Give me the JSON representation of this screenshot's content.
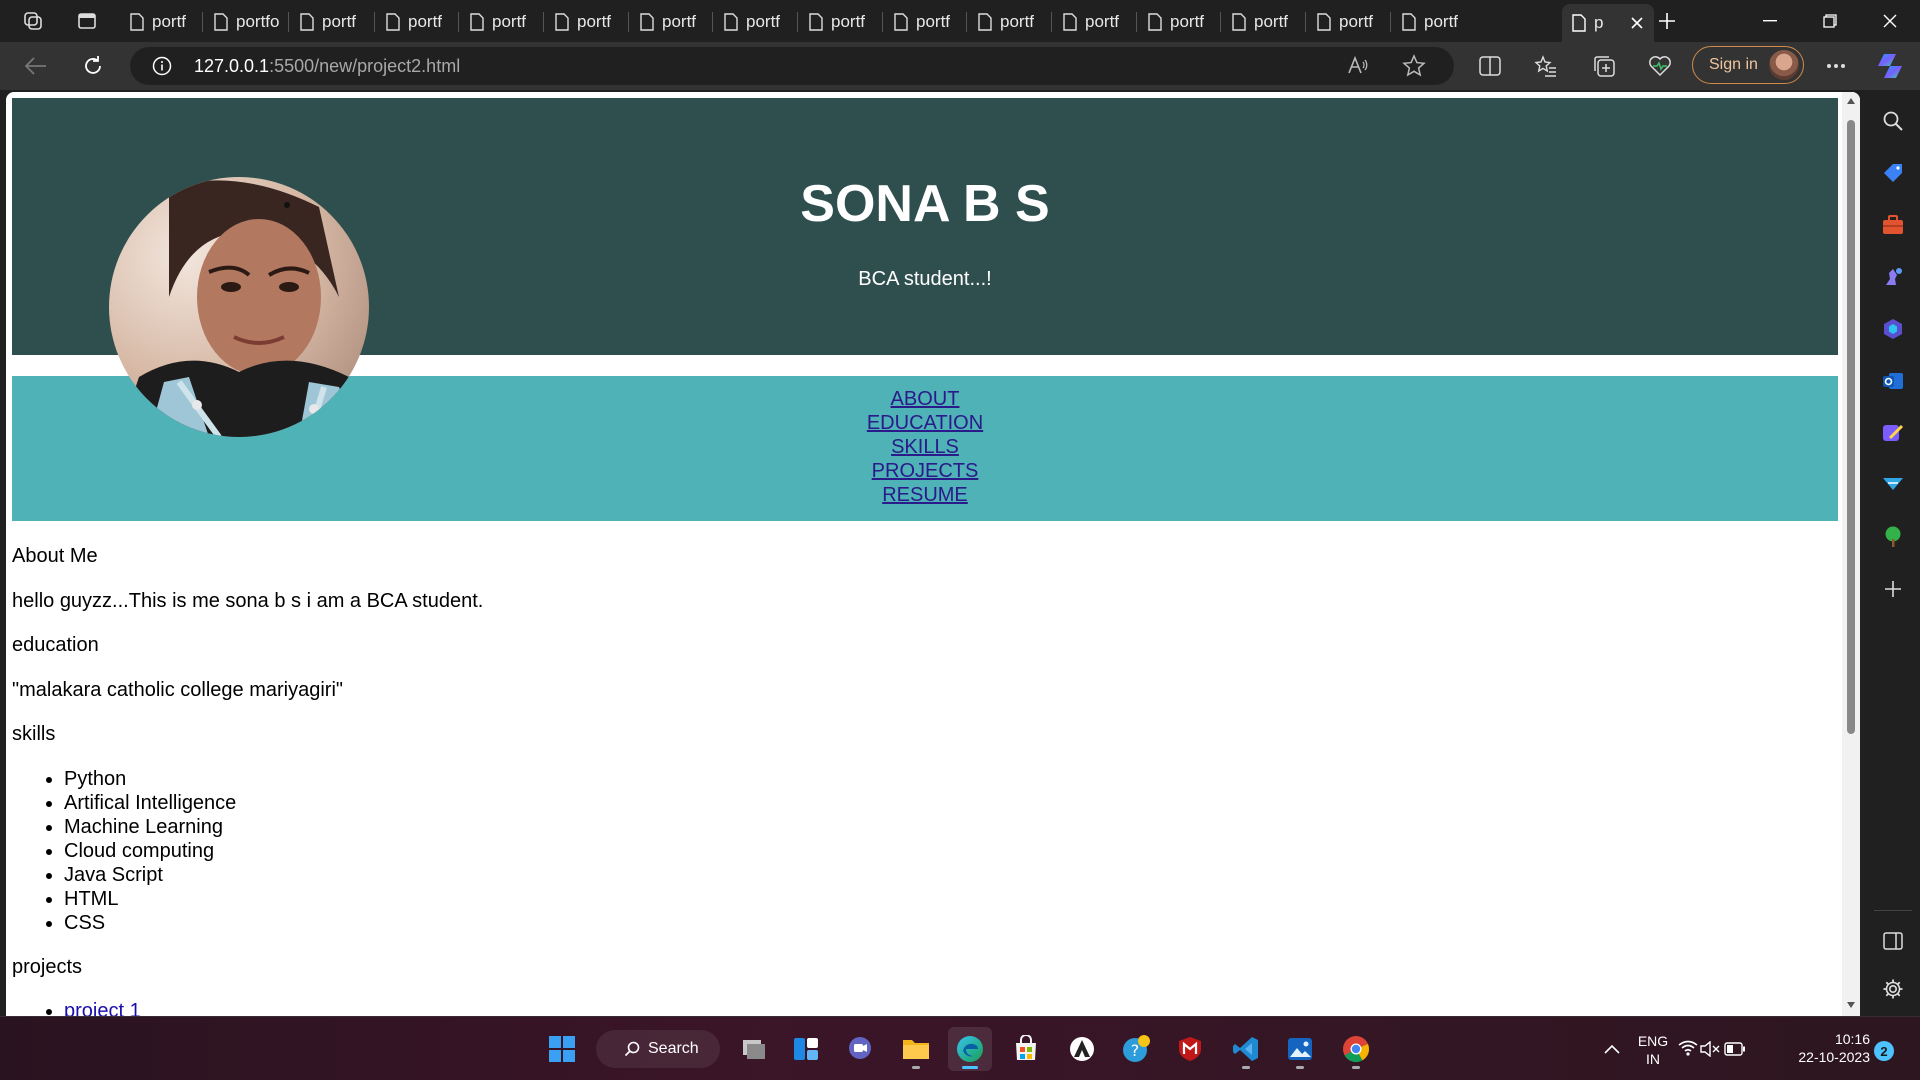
{
  "browser": {
    "tabs": [
      {
        "label": "portf"
      },
      {
        "label": "portfo"
      },
      {
        "label": "portf"
      },
      {
        "label": "portf"
      },
      {
        "label": "portf"
      },
      {
        "label": "portf"
      },
      {
        "label": "portf"
      },
      {
        "label": "portf"
      },
      {
        "label": "portf"
      },
      {
        "label": "portf"
      },
      {
        "label": "portf"
      },
      {
        "label": "portf"
      },
      {
        "label": "portf"
      },
      {
        "label": "portf"
      },
      {
        "label": "portf"
      },
      {
        "label": "portf"
      }
    ],
    "active_tab_label": "p",
    "url_host": "127.0.0.1",
    "url_path": ":5500/new/project2.html",
    "sign_in_label": "Sign in"
  },
  "page": {
    "name": "SONA B S",
    "subtitle": "BCA student...!",
    "nav": [
      "ABOUT",
      "EDUCATION",
      "SKILLS",
      "PROJECTS",
      "RESUME"
    ],
    "about_heading": "About Me",
    "about_text": "hello guyzz...This is me sona b s i am a BCA student.",
    "education_heading": "education",
    "education_text": "\"malakara catholic college mariyagiri\"",
    "skills_heading": "skills",
    "skills": [
      "Python",
      "Artifical Intelligence",
      "Machine Learning",
      "Cloud computing",
      "Java Script",
      "HTML",
      "CSS"
    ],
    "projects_heading": "projects",
    "projects": [
      "project 1"
    ],
    "colors": {
      "hero": "#2f4f4f",
      "nav": "#4eb2b7",
      "link": "#2a1a8a"
    }
  },
  "taskbar": {
    "search_label": "Search",
    "lang_line1": "ENG",
    "lang_line2": "IN",
    "time": "10:16",
    "date": "22-10-2023",
    "notification_count": "2"
  }
}
